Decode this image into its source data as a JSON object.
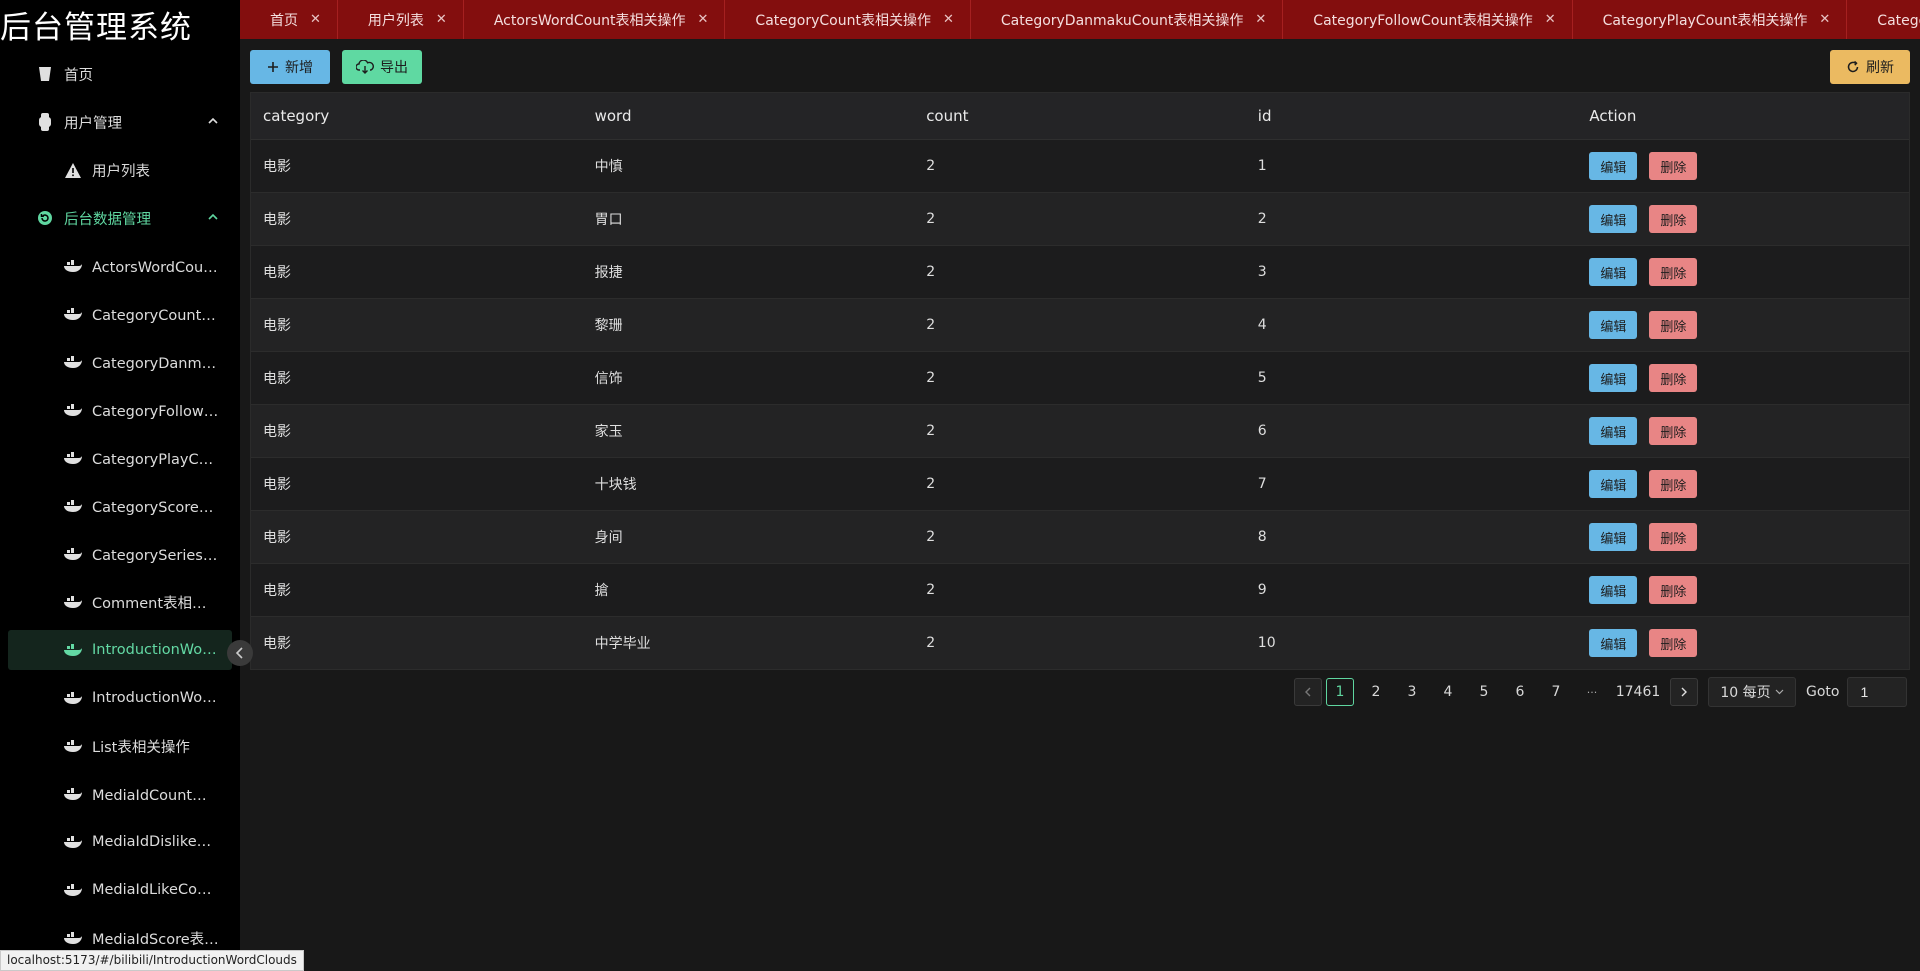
{
  "app": {
    "title": "后台管理系统"
  },
  "sidebar": {
    "items": [
      {
        "label": "首页",
        "icon": "cup-icon"
      },
      {
        "label": "用户管理",
        "icon": "watch-icon"
      },
      {
        "label": "用户列表",
        "icon": "warning-icon"
      },
      {
        "label": "后台数据管理",
        "icon": "refresh-circle-icon"
      },
      {
        "label": "ActorsWordCount表相关操作",
        "icon": "whale-icon"
      },
      {
        "label": "CategoryCount表相关操作",
        "icon": "whale-icon"
      },
      {
        "label": "CategoryDanmakuCount表相关操作",
        "icon": "whale-icon"
      },
      {
        "label": "CategoryFollowCount表相关操作",
        "icon": "whale-icon"
      },
      {
        "label": "CategoryPlayCount表相关操作",
        "icon": "whale-icon"
      },
      {
        "label": "CategoryScore表相关操作",
        "icon": "whale-icon"
      },
      {
        "label": "CategorySeriesFollowCount表相关操作",
        "icon": "whale-icon"
      },
      {
        "label": "Comment表相关操作",
        "icon": "whale-icon"
      },
      {
        "label": "IntroductionWordClouds",
        "icon": "whale-icon"
      },
      {
        "label": "IntroductionWordCount",
        "icon": "whale-icon"
      },
      {
        "label": "List表相关操作",
        "icon": "whale-icon"
      },
      {
        "label": "MediaIdCount表相关操作",
        "icon": "whale-icon"
      },
      {
        "label": "MediaIdDislikeCount",
        "icon": "whale-icon"
      },
      {
        "label": "MediaIdLikeCount",
        "icon": "whale-icon"
      },
      {
        "label": "MediaIdScore表相关操作",
        "icon": "whale-icon"
      }
    ]
  },
  "tabs": [
    {
      "label": "首页"
    },
    {
      "label": "用户列表"
    },
    {
      "label": "ActorsWordCount表相关操作"
    },
    {
      "label": "CategoryCount表相关操作"
    },
    {
      "label": "CategoryDanmakuCount表相关操作"
    },
    {
      "label": "CategoryFollowCount表相关操作"
    },
    {
      "label": "CategoryPlayCount表相关操作"
    },
    {
      "label": "CategoryScore表相关操作"
    }
  ],
  "toolbar": {
    "add_label": "新增",
    "export_label": "导出",
    "refresh_label": "刷新"
  },
  "table": {
    "headers": [
      "category",
      "word",
      "count",
      "id",
      "Action"
    ],
    "edit_label": "编辑",
    "delete_label": "删除",
    "rows": [
      [
        "电影",
        "中慎",
        "2",
        "1"
      ],
      [
        "电影",
        "胃口",
        "2",
        "2"
      ],
      [
        "电影",
        "报捷",
        "2",
        "3"
      ],
      [
        "电影",
        "黎珊",
        "2",
        "4"
      ],
      [
        "电影",
        "信饰",
        "2",
        "5"
      ],
      [
        "电影",
        "家玉",
        "2",
        "6"
      ],
      [
        "电影",
        "十块钱",
        "2",
        "7"
      ],
      [
        "电影",
        "身间",
        "2",
        "8"
      ],
      [
        "电影",
        "搶",
        "2",
        "9"
      ],
      [
        "电影",
        "中学毕业",
        "2",
        "10"
      ]
    ]
  },
  "pagination": {
    "pages": [
      "1",
      "2",
      "3",
      "4",
      "5",
      "6",
      "7"
    ],
    "current": "1",
    "ellipsis": "···",
    "last": "17461",
    "page_size": "10 每页",
    "goto_label": "Goto",
    "goto_value": "1"
  },
  "status_bar": {
    "url": "localhost:5173/#/bilibili/IntroductionWordClouds"
  },
  "colors": {
    "accent": "#5fd6a0",
    "tab_bar": "#830e0e",
    "edit": "#67b7e5",
    "delete": "#e88585",
    "refresh": "#ebba61"
  }
}
